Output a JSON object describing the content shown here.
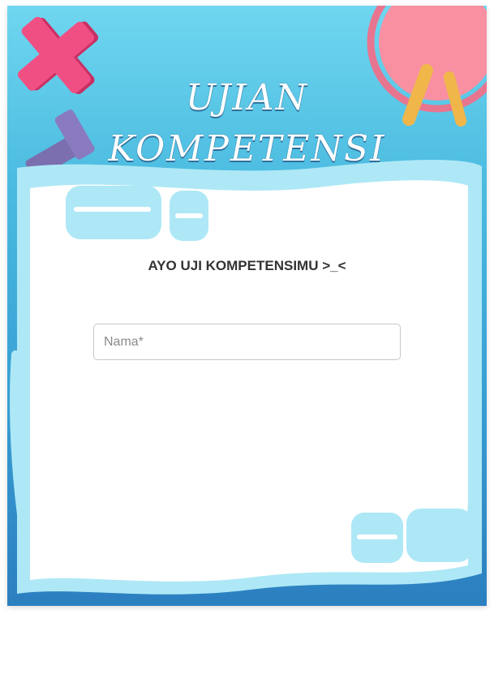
{
  "header": {
    "title_line1": "UJIAN",
    "title_line2": "KOMPETENSI"
  },
  "main": {
    "subtitle": "AYO UJI KOMPETENSIMU >_<"
  },
  "form": {
    "name_placeholder": "Nama*",
    "name_value": ""
  },
  "colors": {
    "bg_top": "#6fd6ef",
    "bg_bottom": "#2c7fc0",
    "plus_pink": "#e94c7c",
    "circle_pink": "#f58ea0",
    "paper_blue": "#aee8f6"
  }
}
